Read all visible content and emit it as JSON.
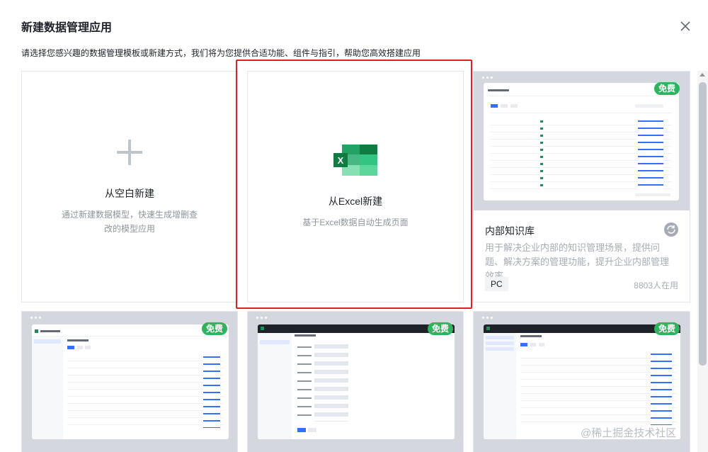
{
  "dialog": {
    "title": "新建数据管理应用",
    "subtitle": "请选择您感兴趣的数据管理模板或新建方式，我们将为您提供合适功能、组件与指引，帮助您高效搭建应用",
    "close_icon": "close-icon"
  },
  "cards": {
    "blank": {
      "icon": "plus-icon",
      "title": "从空白新建",
      "desc": "通过新建数据模型，快速生成增删查改的模型应用"
    },
    "excel": {
      "icon": "excel-icon",
      "title": "从Excel新建",
      "desc": "基于Excel数据自动生成页面",
      "selected": true
    },
    "knowledge": {
      "badge": "免费",
      "title": "内部知识库",
      "desc": "用于解决企业内部的知识管理场景，提供问题、解决方案的管理功能，提升企业内部管理效率。",
      "tag": "PC",
      "usage": "8803人在用",
      "status_icon": "sync-icon"
    },
    "template2": {
      "badge": "免费"
    },
    "template3": {
      "badge": "免费"
    },
    "template4": {
      "badge": "免费"
    }
  },
  "colors": {
    "selected_border": "#e02020",
    "badge_green": "#2fb35f",
    "excel_green": "#1e8e5a"
  },
  "watermark": "@稀土掘金技术社区"
}
